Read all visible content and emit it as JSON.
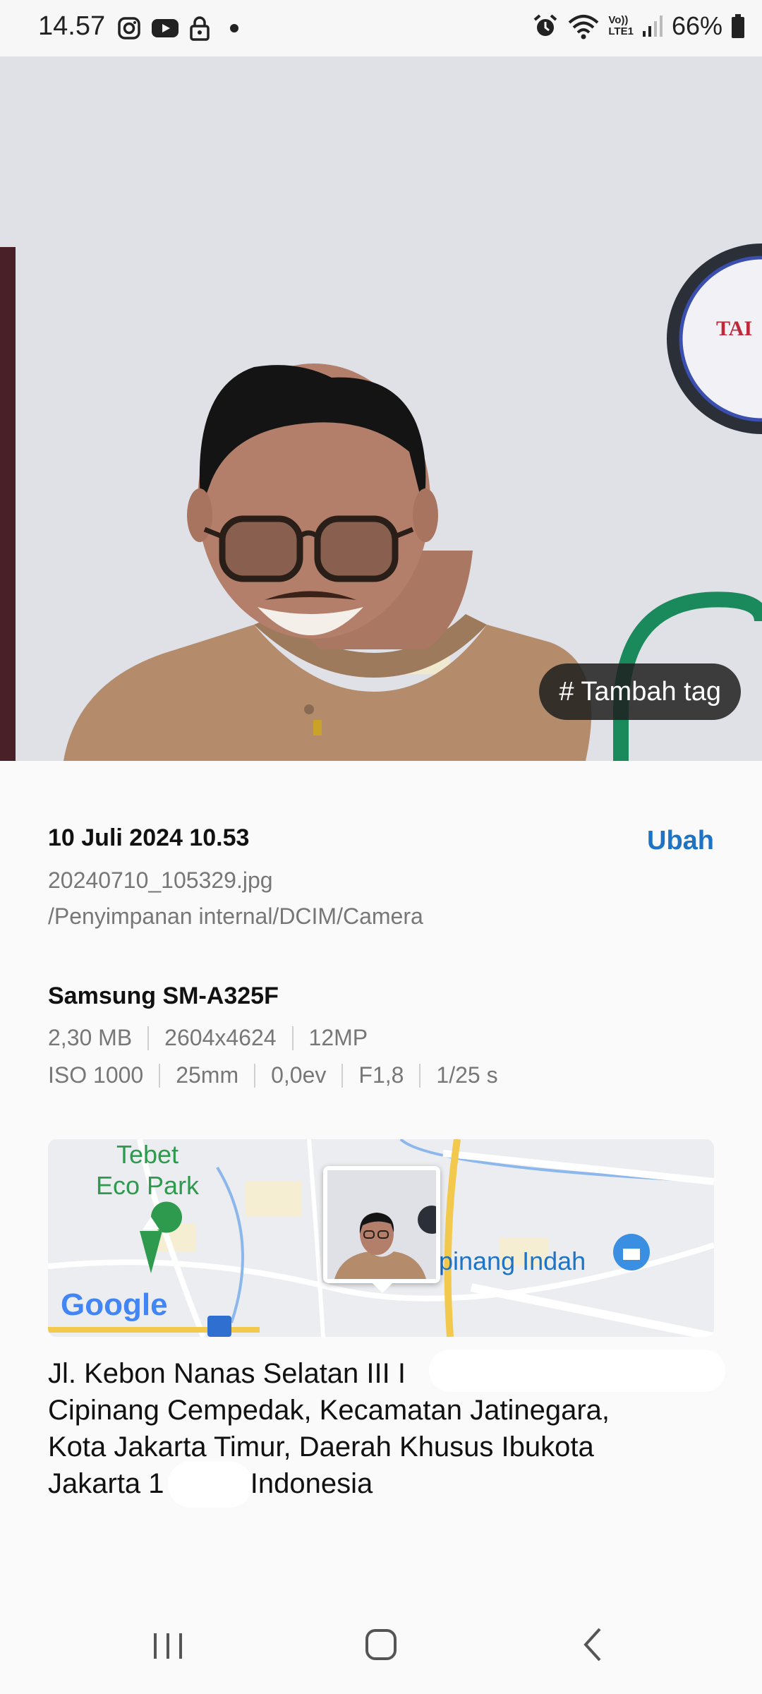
{
  "status_bar": {
    "time": "14.57",
    "battery": "66%",
    "icons": [
      "instagram-icon",
      "youtube-icon",
      "lock-icon",
      "dot-icon",
      "alarm-icon",
      "wifi-icon",
      "volte-icon",
      "signal-icon",
      "battery-icon"
    ],
    "volte_top": "Vo))",
    "volte_bottom": "LTE1"
  },
  "photo": {
    "tag_button_label": "# Tambah tag"
  },
  "details": {
    "date": "10 Juli 2024 10.53",
    "edit_label": "Ubah",
    "filename": "20240710_105329.jpg",
    "path": "/Penyimpanan internal/DCIM/Camera"
  },
  "device": {
    "model": "Samsung SM-A325F",
    "row1": [
      "2,30 MB",
      "2604x4624",
      "12MP"
    ],
    "row2": [
      "ISO 1000",
      "25mm",
      "0,0ev",
      "F1,8",
      "1/25 s"
    ]
  },
  "map": {
    "park_label_1": "Tebet",
    "park_label_2": "Eco Park",
    "place_label": "Cipinang Indah",
    "google_logo": "Google"
  },
  "address": {
    "line1": "Jl. Kebon Nanas Selatan III I",
    "line2": "Cipinang Cempedak, Kecamatan Jatinegara,",
    "line3": "Kota Jakarta Timur, Daerah Khusus Ibukota",
    "line4a": "Jakarta 1",
    "line4b": ", Indonesia"
  },
  "colors": {
    "accent": "#1d74c6",
    "tag_bg": "#2a2a2a",
    "map_green": "#2e9a4d"
  }
}
